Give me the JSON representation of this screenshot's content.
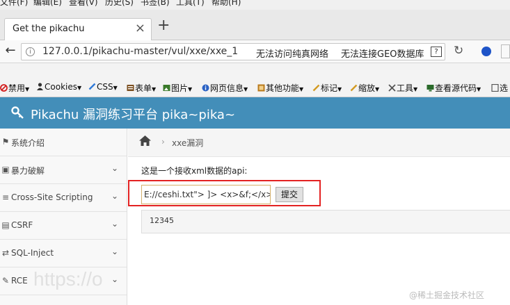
{
  "browser": {
    "menu": [
      "文件(F)",
      "编辑(E)",
      "查看(V)",
      "历史(S)",
      "书签(B)",
      "工具(T)",
      "帮助(H)"
    ],
    "tab_title": "Get the pikachu",
    "tab_close": "×",
    "new_tab": "+",
    "url": "127.0.0.1/pikachu-master/vul/xxe/xxe_1.php",
    "addr_msg_1": "无法访问纯真网络",
    "addr_msg_2": "无法连接GEO数据库",
    "help_glyph": "?",
    "toolbar": [
      {
        "label": "禁用",
        "icon": "forbid-icon",
        "color": "#d32020"
      },
      {
        "label": "Cookies",
        "icon": "person-icon",
        "color": "#333333"
      },
      {
        "label": "CSS",
        "icon": "pencil-icon",
        "color": "#2f7ad8"
      },
      {
        "label": "表单",
        "icon": "form-icon",
        "color": "#7a4d1e"
      },
      {
        "label": "图片",
        "icon": "image-icon",
        "color": "#3a7a2a"
      },
      {
        "label": "网页信息",
        "icon": "info-icon",
        "color": "#2b62c4"
      },
      {
        "label": "其他功能",
        "icon": "box-icon",
        "color": "#b87a1c"
      },
      {
        "label": "标记",
        "icon": "pencil-icon",
        "color": "#d39a21"
      },
      {
        "label": "缩放",
        "icon": "resize-icon",
        "color": "#d39a21"
      },
      {
        "label": "工具",
        "icon": "tools-icon",
        "color": "#555555"
      },
      {
        "label": "查看源代码",
        "icon": "monitor-icon",
        "color": "#2a6a2a"
      },
      {
        "label": "选",
        "icon": "page-icon",
        "color": "#555555"
      }
    ]
  },
  "header": {
    "title": "Pikachu 漏洞练习平台 pika~pika~"
  },
  "sidebar": {
    "items": [
      {
        "label": "系统介绍",
        "icon": "tag-icon",
        "has_chevron": false
      },
      {
        "label": "暴力破解",
        "icon": "lock-icon",
        "has_chevron": true
      },
      {
        "label": "Cross-Site Scripting",
        "icon": "list-icon",
        "has_chevron": true
      },
      {
        "label": "CSRF",
        "icon": "document-icon",
        "has_chevron": true
      },
      {
        "label": "SQL-Inject",
        "icon": "arrows-icon",
        "has_chevron": true
      },
      {
        "label": "RCE",
        "icon": "pencil-icon",
        "has_chevron": true
      }
    ]
  },
  "main": {
    "breadcrumb_sep": "›",
    "breadcrumb_current": "xxe漏洞",
    "api_label": "这是一个接收xml数据的api:",
    "xml_input_value": "E://ceshi.txt\"> ]> <x>&f;</x>",
    "submit_label": "提交",
    "result": "12345"
  },
  "watermark": {
    "url_fragment": "https://o",
    "site": "@稀土掘金技术社区"
  },
  "colors": {
    "header_bg": "#438eb9",
    "highlight_border": "#e32222"
  }
}
